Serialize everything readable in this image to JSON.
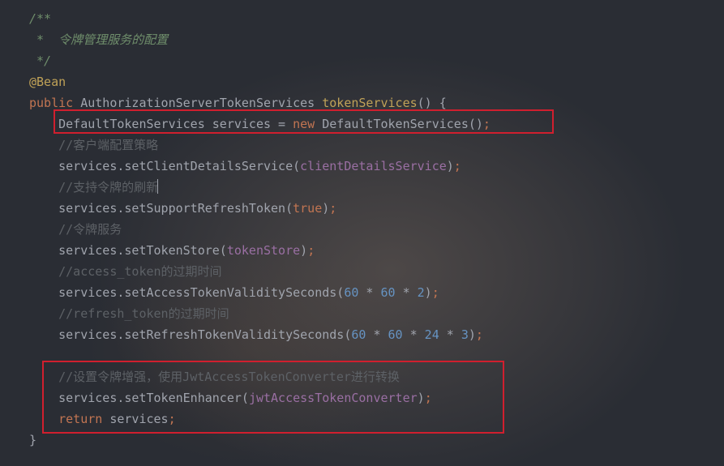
{
  "code": {
    "doc1": "/**",
    "doc2": " *  令牌管理服务的配置",
    "doc3": " */",
    "anno": "@Bean",
    "kw_public": "public",
    "type_ret": " AuthorizationServerTokenServices ",
    "fn_name": "tokenServices",
    "sig_tail": "() {",
    "l1_a": "DefaultTokenServices services = ",
    "l1_new": "new",
    "l1_b": " DefaultTokenServices()",
    "semi": ";",
    "cmt_client": "//客户端配置策略",
    "l2_a": "services.setClientDetailsService(",
    "l2_field": "clientDetailsService",
    "l2_b": ")",
    "cmt_refresh": "//支持令牌的刷新",
    "l3_a": "services.setSupportRefreshToken(",
    "l3_bool": "true",
    "l3_b": ")",
    "cmt_tokensvc": "//令牌服务",
    "l4_a": "services.setTokenStore(",
    "l4_field": "tokenStore",
    "l4_b": ")",
    "cmt_access": "//access_token的过期时间",
    "l5_a": "services.setAccessTokenValiditySeconds(",
    "l5_n1": "60",
    "star": " * ",
    "l5_n2": "60",
    "l5_n3": "2",
    "l5_b": ")",
    "cmt_refreshtok": "//refresh_token的过期时间",
    "l6_a": "services.setRefreshTokenValiditySeconds(",
    "l6_n1": "60",
    "l6_n2": "60",
    "l6_n3": "24",
    "l6_n4": "3",
    "l6_b": ")",
    "blank": "",
    "cmt_enh": "//设置令牌增强，使用JwtAccessTokenConverter进行转换",
    "l7_a": "services.setTokenEnhancer(",
    "l7_field": "jwtAccessTokenConverter",
    "l7_b": ")",
    "kw_return": "return",
    "l8_a": " services",
    "brace_close": "}"
  }
}
